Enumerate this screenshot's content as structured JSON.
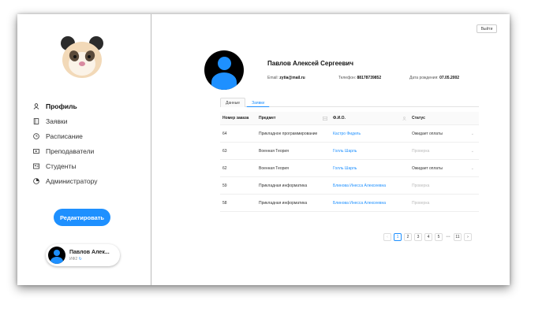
{
  "header": {
    "logout_label": "Выйти"
  },
  "sidebar": {
    "items": [
      {
        "label": "Профиль",
        "icon": "user-icon",
        "active": true
      },
      {
        "label": "Заявки",
        "icon": "document-icon"
      },
      {
        "label": "Расписание",
        "icon": "clock-icon"
      },
      {
        "label": "Преподаватели",
        "icon": "video-icon"
      },
      {
        "label": "Студенты",
        "icon": "id-card-icon"
      },
      {
        "label": "Администратору",
        "icon": "pie-chart-icon"
      }
    ],
    "edit_button": "Редактировать",
    "user_card": {
      "name": "Павлов Алек...",
      "sub": "ИФ2"
    }
  },
  "profile": {
    "name": "Павлов Алексей Сергеевич",
    "email_label": "Email:",
    "email": "zytia@mail.ru",
    "phone_label": "Телефон:",
    "phone": "88178739852",
    "dob_label": "Дата рождения:",
    "dob": "07.05.2002"
  },
  "tabs": [
    {
      "label": "Данные",
      "active": false
    },
    {
      "label": "Заявки",
      "active": true
    }
  ],
  "table": {
    "headers": [
      "Номер заказа",
      "Предмет",
      "Ф.И.О.",
      "Статус"
    ],
    "rows": [
      {
        "id": "64",
        "subject": "Прикладное программирование",
        "person": "Кастро Фидель",
        "status": "Ожидает оплаты",
        "status_muted": false
      },
      {
        "id": "63",
        "subject": "Военная Теория",
        "person": "Голль Шарль",
        "status": "Проверка",
        "status_muted": true
      },
      {
        "id": "62",
        "subject": "Военная Теория",
        "person": "Голль Шарль",
        "status": "Ожидает оплаты",
        "status_muted": false
      },
      {
        "id": "59",
        "subject": "Прикладная информатика",
        "person": "Блинова Инесса Алексеевна",
        "status": "Проверка",
        "status_muted": true
      },
      {
        "id": "58",
        "subject": "Прикладная информатика",
        "person": "Блинова Инесса Алексеевна",
        "status": "Проверка",
        "status_muted": true
      }
    ]
  },
  "pagination": {
    "prev": "‹",
    "pages": [
      "1",
      "2",
      "3",
      "4",
      "5"
    ],
    "ellipsis": "•••",
    "last": "11",
    "next": "›",
    "current": "1"
  },
  "colors": {
    "accent": "#1e90ff",
    "avatar_bg": "#000000"
  }
}
